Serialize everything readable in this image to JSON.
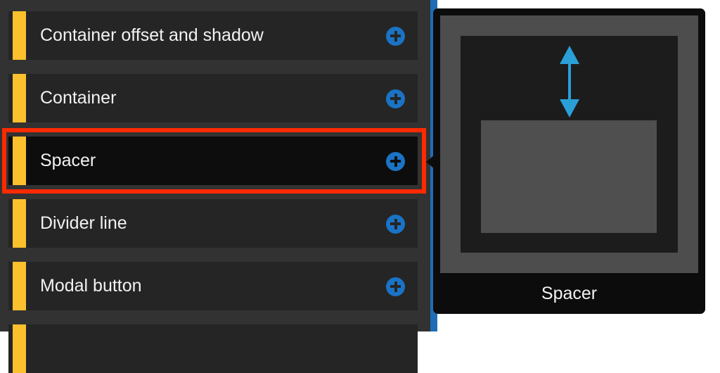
{
  "items": [
    {
      "label": "Container offset and shadow"
    },
    {
      "label": "Container"
    },
    {
      "label": "Spacer"
    },
    {
      "label": "Divider line"
    },
    {
      "label": "Modal button"
    }
  ],
  "preview": {
    "title": "Spacer"
  },
  "colors": {
    "accent": "#fbc02d",
    "add_button": "#1a73c5",
    "highlight": "#ff2a00",
    "arrow": "#2a9fd8"
  }
}
